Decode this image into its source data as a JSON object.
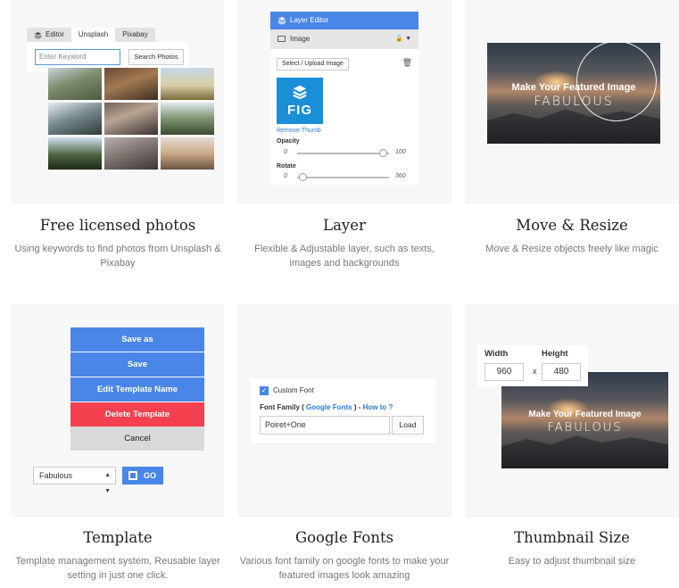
{
  "features": [
    {
      "title": "Free licensed photos",
      "description": "Using keywords to find photos from Unsplash & Pixabay"
    },
    {
      "title": "Layer",
      "description": "Flexible & Adjustable layer, such as texts, images and backgrounds"
    },
    {
      "title": "Move & Resize",
      "description": "Move & Resize objects freely like magic"
    },
    {
      "title": "Template",
      "description": "Template management system, Reusable layer setting in just one click."
    },
    {
      "title": "Google Fonts",
      "description": "Various font family on google fonts to make your featured images look amazing"
    },
    {
      "title": "Thumbnail Size",
      "description": "Easy to adjust thumbnail size"
    }
  ],
  "photo_search": {
    "tabs": [
      "Editor",
      "Unsplash",
      "Pixabay"
    ],
    "keyword_placeholder": "Enter Keyword",
    "search_button": "Search Photos"
  },
  "layer_editor": {
    "title": "Layer Editor",
    "layer_name": "Image",
    "upload_button": "Select / Upload Image",
    "logo_text": "FIG",
    "remove_thumb": "Remove Thumb",
    "opacity_label": "Opacity",
    "opacity_min": "0",
    "opacity_max": "100",
    "opacity_value": 1.0,
    "rotate_label": "Rotate",
    "rotate_min": "0",
    "rotate_max": "360",
    "rotate_value": 0
  },
  "move_resize": {
    "line1": "Make Your Featured Image",
    "line2": "FABULOUS"
  },
  "template": {
    "save_as": "Save as",
    "save": "Save",
    "edit_name": "Edit Template Name",
    "delete": "Delete Template",
    "cancel": "Cancel",
    "selected": "Fabulous",
    "go": "GO"
  },
  "google_fonts": {
    "custom_font_label": "Custom Font",
    "custom_font_checked": true,
    "family_label": "Font Family (",
    "google_fonts_link": "Google Fonts",
    "family_sep": ") -",
    "how_to": "How to ?",
    "font_value": "Poiret+One",
    "load_button": "Load"
  },
  "thumbnail_size": {
    "width_label": "Width",
    "height_label": "Height",
    "width_value": "960",
    "separator": "x",
    "height_value": "480",
    "line1": "Make Your Featured Image",
    "line2": "FABULOUS"
  },
  "colors": {
    "card_bg": "#f7f7f7",
    "accent_blue": "#4a86e8",
    "delete_red": "#f4404f",
    "cancel_grey": "#d9d9d9",
    "link_blue": "#2a7ae2"
  }
}
